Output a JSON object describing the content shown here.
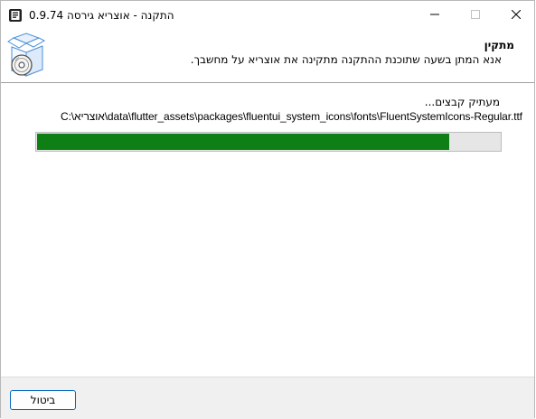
{
  "window": {
    "title": "התקנה - אוצריא גירסה 0.9.74",
    "controls": {
      "minimize_icon": "minimize-icon",
      "maximize_icon": "maximize-icon",
      "close_icon": "close-icon"
    }
  },
  "header": {
    "title": "מתקין",
    "subtitle": "אנא המתן בשעה שתוכנת ההתקנה מתקינה את אוצריא על מחשבך.",
    "icon": "installer-box-icon"
  },
  "main": {
    "status": "מעתיק קבצים...",
    "current_file": "C:\\אוצריא\\data\\flutter_assets\\packages\\fluentui_system_icons\\fonts\\FluentSystemIcons-Regular.ttf",
    "progress_fraction": 0.89
  },
  "footer": {
    "cancel_label": "ביטול"
  },
  "colors": {
    "progress_fill": "#0e7f14",
    "progress_track": "#e6e6e6",
    "button_border": "#0067c0",
    "footer_bg": "#f0f0f0"
  }
}
